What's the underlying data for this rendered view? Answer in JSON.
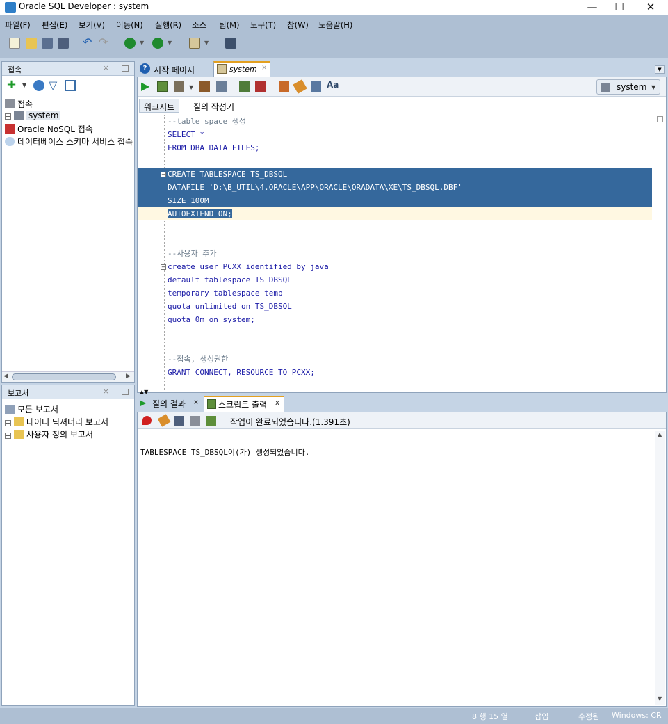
{
  "window": {
    "title": "Oracle SQL Developer : system"
  },
  "menu": [
    "파일(F)",
    "편집(E)",
    "보기(V)",
    "이동(N)",
    "실행(R)",
    "소스",
    "팀(M)",
    "도구(T)",
    "창(W)",
    "도움말(H)"
  ],
  "connections": {
    "title": "접속",
    "root": "접속",
    "items": [
      "system",
      "Oracle NoSQL 접속",
      "데이터베이스 스키마 서비스 접속"
    ]
  },
  "reports": {
    "title": "보고서",
    "items": [
      "모든 보고서",
      "데이터 딕셔너리 보고서",
      "사용자 정의 보고서"
    ]
  },
  "editor_tabs": [
    "시작 페이지",
    "system"
  ],
  "connection_select": "system",
  "subtabs": [
    "워크시트",
    "질의 작성기"
  ],
  "code": [
    "--table space 생성",
    "SELECT *",
    "FROM DBA_DATA_FILES;",
    "",
    "CREATE TABLESPACE TS_DBSQL",
    "DATAFILE 'D:\\B_UTIL\\4.ORACLE\\APP\\ORACLE\\ORADATA\\XE\\TS_DBSQL.DBF'",
    "SIZE 100M",
    "AUTOEXTEND ON;",
    "",
    "",
    "--사용자 추가",
    "create user PCXX identified by java",
    "default tablespace TS_DBSQL",
    "temporary tablespace temp",
    "quota unlimited on TS_DBSQL",
    "quota 0m on system;",
    "",
    "",
    "--접속, 생성권한",
    "GRANT CONNECT, RESOURCE TO PCXX;"
  ],
  "output_tabs": [
    "질의 결과",
    "스크립트 출력"
  ],
  "output_status": "작업이 완료되었습니다.(1.391초)",
  "output_text": "TABLESPACE TS_DBSQL이(가) 생성되었습니다.",
  "statusbar": {
    "position": "8 행 15 열",
    "mode": "삽입",
    "modified": "수정됨",
    "line_ending": "Windows: CR"
  },
  "colors": {
    "selection": "#35689c",
    "keyword": "#1a1aa6",
    "comment": "#6b7b8b"
  }
}
